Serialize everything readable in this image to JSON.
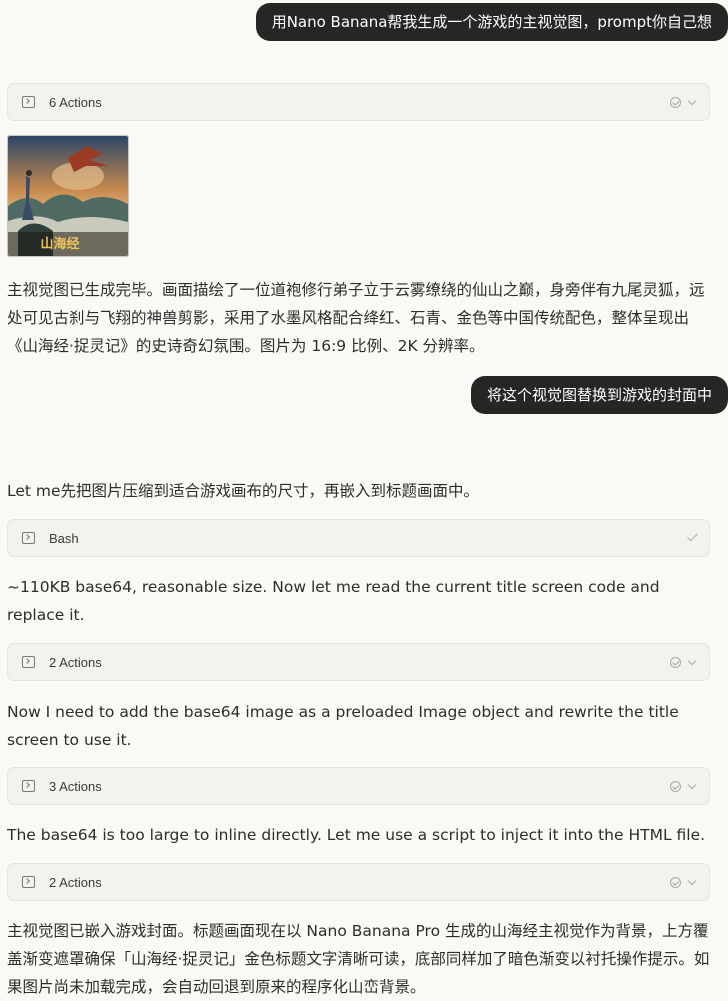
{
  "messages": {
    "user_1": "用Nano Banana帮我生成一个游戏的主视觉图，prompt你自己想",
    "user_2": "将这个视觉图替换到游戏的封面中"
  },
  "tool_cards": [
    {
      "label": "6 Actions",
      "status_icon": "circle-check-icon"
    },
    {
      "label": "Bash",
      "status_icon": "check-icon"
    },
    {
      "label": "2 Actions",
      "status_icon": "circle-check-icon"
    },
    {
      "label": "3 Actions",
      "status_icon": "circle-check-icon"
    },
    {
      "label": "2 Actions",
      "status_icon": "circle-check-icon"
    }
  ],
  "thumbnail": {
    "logo_text": "山海经"
  },
  "assistant": {
    "p1": "主视觉图已生成完毕。画面描绘了一位道袍修行弟子立于云雾缭绕的仙山之巅，身旁伴有九尾灵狐，远处可见古刹与飞翔的神兽剪影，采用了水墨风格配合绛红、石青、金色等中国传统配色，整体呈现出《山海经·捉灵记》的史诗奇幻氛围。图片为 16:9 比例、2K 分辨率。",
    "p2": "Let me先把图片压缩到适合游戏画布的尺寸，再嵌入到标题画面中。",
    "p3": "~110KB base64, reasonable size. Now let me read the current title screen code and replace it.",
    "p4": "Now I need to add the base64 image as a preloaded Image object and rewrite the title screen to use it.",
    "p5": "The base64 is too large to inline directly. Let me use a script to inject it into the HTML file.",
    "p6": "主视觉图已嵌入游戏封面。标题画面现在以 Nano Banana Pro 生成的山海经主视觉作为背景，上方覆盖渐变遮罩确保「山海经·捉灵记」金色标题文字清晰可读，底部同样加了暗色渐变以衬托操作提示。如果图片尚未加载完成，会自动回退到原来的程序化山峦背景。"
  },
  "colors": {
    "background": "#faf9f5",
    "user_bubble": "#262624",
    "card_bg": "#f3f2ed"
  }
}
